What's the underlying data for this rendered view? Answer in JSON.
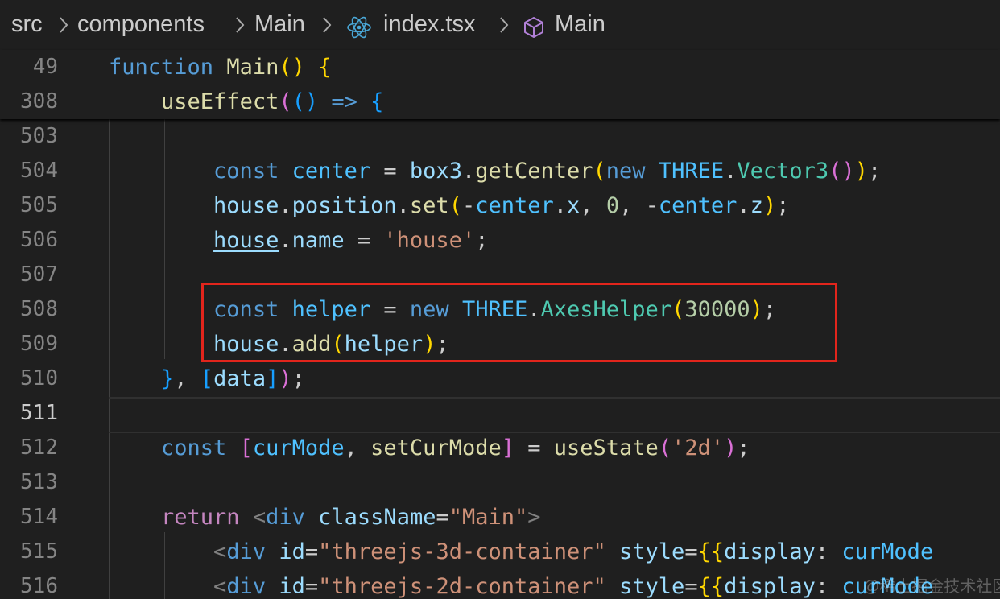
{
  "breadcrumb": {
    "items": [
      "src",
      "components",
      "Main",
      "index.tsx",
      "Main"
    ],
    "separator": ">",
    "file_icon": "react-icon",
    "symbol_icon": "cube-symbol-icon"
  },
  "theme": {
    "background": "#1f1f1f",
    "keyword": "#569cd6",
    "control": "#c586c0",
    "function": "#dcdcaa",
    "variable": "#9cdcfe",
    "constant": "#4fc1ff",
    "class": "#4ec9b0",
    "string": "#ce9178",
    "number": "#b5cea8",
    "highlight_box": "#e2251c"
  },
  "sticky_scroll": [
    {
      "number": "49",
      "tokens": [
        {
          "t": "function",
          "c": "t-kw"
        },
        {
          "t": " "
        },
        {
          "t": "Main",
          "c": "t-fn"
        },
        {
          "t": "()",
          "c": "t-br1"
        },
        {
          "t": " "
        },
        {
          "t": "{",
          "c": "t-br1"
        }
      ]
    },
    {
      "number": "308",
      "tokens": [
        {
          "t": "    "
        },
        {
          "t": "useEffect",
          "c": "t-fn"
        },
        {
          "t": "(",
          "c": "t-br2"
        },
        {
          "t": "()",
          "c": "t-br3"
        },
        {
          "t": " "
        },
        {
          "t": "=>",
          "c": "t-kw"
        },
        {
          "t": " "
        },
        {
          "t": "{",
          "c": "t-br3"
        }
      ]
    }
  ],
  "code_lines": [
    {
      "number": "503",
      "tokens": []
    },
    {
      "number": "504",
      "tokens": [
        {
          "t": "        "
        },
        {
          "t": "const",
          "c": "t-kw"
        },
        {
          "t": " "
        },
        {
          "t": "center",
          "c": "t-const"
        },
        {
          "t": " = "
        },
        {
          "t": "box3",
          "c": "t-var"
        },
        {
          "t": "."
        },
        {
          "t": "getCenter",
          "c": "t-fn"
        },
        {
          "t": "(",
          "c": "t-br1"
        },
        {
          "t": "new",
          "c": "t-kw"
        },
        {
          "t": " "
        },
        {
          "t": "THREE",
          "c": "t-const"
        },
        {
          "t": "."
        },
        {
          "t": "Vector3",
          "c": "t-cls"
        },
        {
          "t": "()",
          "c": "t-br2"
        },
        {
          "t": ")",
          "c": "t-br1"
        },
        {
          "t": ";"
        }
      ]
    },
    {
      "number": "505",
      "tokens": [
        {
          "t": "        "
        },
        {
          "t": "house",
          "c": "t-var"
        },
        {
          "t": "."
        },
        {
          "t": "position",
          "c": "t-var"
        },
        {
          "t": "."
        },
        {
          "t": "set",
          "c": "t-fn"
        },
        {
          "t": "(",
          "c": "t-br1"
        },
        {
          "t": "-"
        },
        {
          "t": "center",
          "c": "t-const"
        },
        {
          "t": "."
        },
        {
          "t": "x",
          "c": "t-var"
        },
        {
          "t": ", "
        },
        {
          "t": "0",
          "c": "t-num"
        },
        {
          "t": ", -"
        },
        {
          "t": "center",
          "c": "t-const"
        },
        {
          "t": "."
        },
        {
          "t": "z",
          "c": "t-var"
        },
        {
          "t": ")",
          "c": "t-br1"
        },
        {
          "t": ";"
        }
      ]
    },
    {
      "number": "506",
      "tokens": [
        {
          "t": "        "
        },
        {
          "t": "house",
          "c": "t-var t-u"
        },
        {
          "t": "."
        },
        {
          "t": "name",
          "c": "t-var"
        },
        {
          "t": " = "
        },
        {
          "t": "'house'",
          "c": "t-str"
        },
        {
          "t": ";"
        }
      ]
    },
    {
      "number": "507",
      "tokens": []
    },
    {
      "number": "508",
      "tokens": [
        {
          "t": "        "
        },
        {
          "t": "const",
          "c": "t-kw"
        },
        {
          "t": " "
        },
        {
          "t": "helper",
          "c": "t-const"
        },
        {
          "t": " = "
        },
        {
          "t": "new",
          "c": "t-kw"
        },
        {
          "t": " "
        },
        {
          "t": "THREE",
          "c": "t-const"
        },
        {
          "t": "."
        },
        {
          "t": "AxesHelper",
          "c": "t-cls"
        },
        {
          "t": "(",
          "c": "t-br1"
        },
        {
          "t": "30000",
          "c": "t-num"
        },
        {
          "t": ")",
          "c": "t-br1"
        },
        {
          "t": ";"
        }
      ]
    },
    {
      "number": "509",
      "tokens": [
        {
          "t": "        "
        },
        {
          "t": "house",
          "c": "t-var"
        },
        {
          "t": "."
        },
        {
          "t": "add",
          "c": "t-fn"
        },
        {
          "t": "(",
          "c": "t-br1"
        },
        {
          "t": "helper",
          "c": "t-var"
        },
        {
          "t": ")",
          "c": "t-br1"
        },
        {
          "t": ";"
        }
      ]
    },
    {
      "number": "510",
      "tokens": [
        {
          "t": "    "
        },
        {
          "t": "}",
          "c": "t-br3"
        },
        {
          "t": ", "
        },
        {
          "t": "[",
          "c": "t-br3"
        },
        {
          "t": "data",
          "c": "t-var"
        },
        {
          "t": "]",
          "c": "t-br3"
        },
        {
          "t": ")",
          "c": "t-br2"
        },
        {
          "t": ";"
        }
      ]
    },
    {
      "number": "511",
      "tokens": []
    },
    {
      "number": "512",
      "tokens": [
        {
          "t": "    "
        },
        {
          "t": "const",
          "c": "t-kw"
        },
        {
          "t": " "
        },
        {
          "t": "[",
          "c": "t-br2"
        },
        {
          "t": "curMode",
          "c": "t-const"
        },
        {
          "t": ", "
        },
        {
          "t": "setCurMode",
          "c": "t-fn"
        },
        {
          "t": "]",
          "c": "t-br2"
        },
        {
          "t": " = "
        },
        {
          "t": "useState",
          "c": "t-fn"
        },
        {
          "t": "(",
          "c": "t-br2"
        },
        {
          "t": "'2d'",
          "c": "t-str"
        },
        {
          "t": ")",
          "c": "t-br2"
        },
        {
          "t": ";"
        }
      ]
    },
    {
      "number": "513",
      "tokens": []
    },
    {
      "number": "514",
      "tokens": [
        {
          "t": "    "
        },
        {
          "t": "return",
          "c": "t-ctl"
        },
        {
          "t": " "
        },
        {
          "t": "<",
          "c": "t-tag"
        },
        {
          "t": "div",
          "c": "t-tagname"
        },
        {
          "t": " "
        },
        {
          "t": "className",
          "c": "t-attr"
        },
        {
          "t": "="
        },
        {
          "t": "\"Main\"",
          "c": "t-str"
        },
        {
          "t": ">",
          "c": "t-tag"
        }
      ]
    },
    {
      "number": "515",
      "tokens": [
        {
          "t": "        "
        },
        {
          "t": "<",
          "c": "t-tag"
        },
        {
          "t": "div",
          "c": "t-tagname"
        },
        {
          "t": " "
        },
        {
          "t": "id",
          "c": "t-attr"
        },
        {
          "t": "="
        },
        {
          "t": "\"threejs-3d-container\"",
          "c": "t-str"
        },
        {
          "t": " "
        },
        {
          "t": "style",
          "c": "t-attr"
        },
        {
          "t": "="
        },
        {
          "t": "{{",
          "c": "t-br1"
        },
        {
          "t": "display",
          "c": "t-attr"
        },
        {
          "t": ": "
        },
        {
          "t": "curMode",
          "c": "t-const"
        }
      ]
    },
    {
      "number": "516",
      "tokens": [
        {
          "t": "        "
        },
        {
          "t": "<",
          "c": "t-tag"
        },
        {
          "t": "div",
          "c": "t-tagname"
        },
        {
          "t": " "
        },
        {
          "t": "id",
          "c": "t-attr"
        },
        {
          "t": "="
        },
        {
          "t": "\"threejs-2d-container\"",
          "c": "t-str"
        },
        {
          "t": " "
        },
        {
          "t": "style",
          "c": "t-attr"
        },
        {
          "t": "="
        },
        {
          "t": "{{",
          "c": "t-br1"
        },
        {
          "t": "display",
          "c": "t-attr"
        },
        {
          "t": ": "
        },
        {
          "t": "curMode",
          "c": "t-const"
        }
      ]
    }
  ],
  "current_line": "511",
  "watermark": "@稀土掘金技术社区"
}
